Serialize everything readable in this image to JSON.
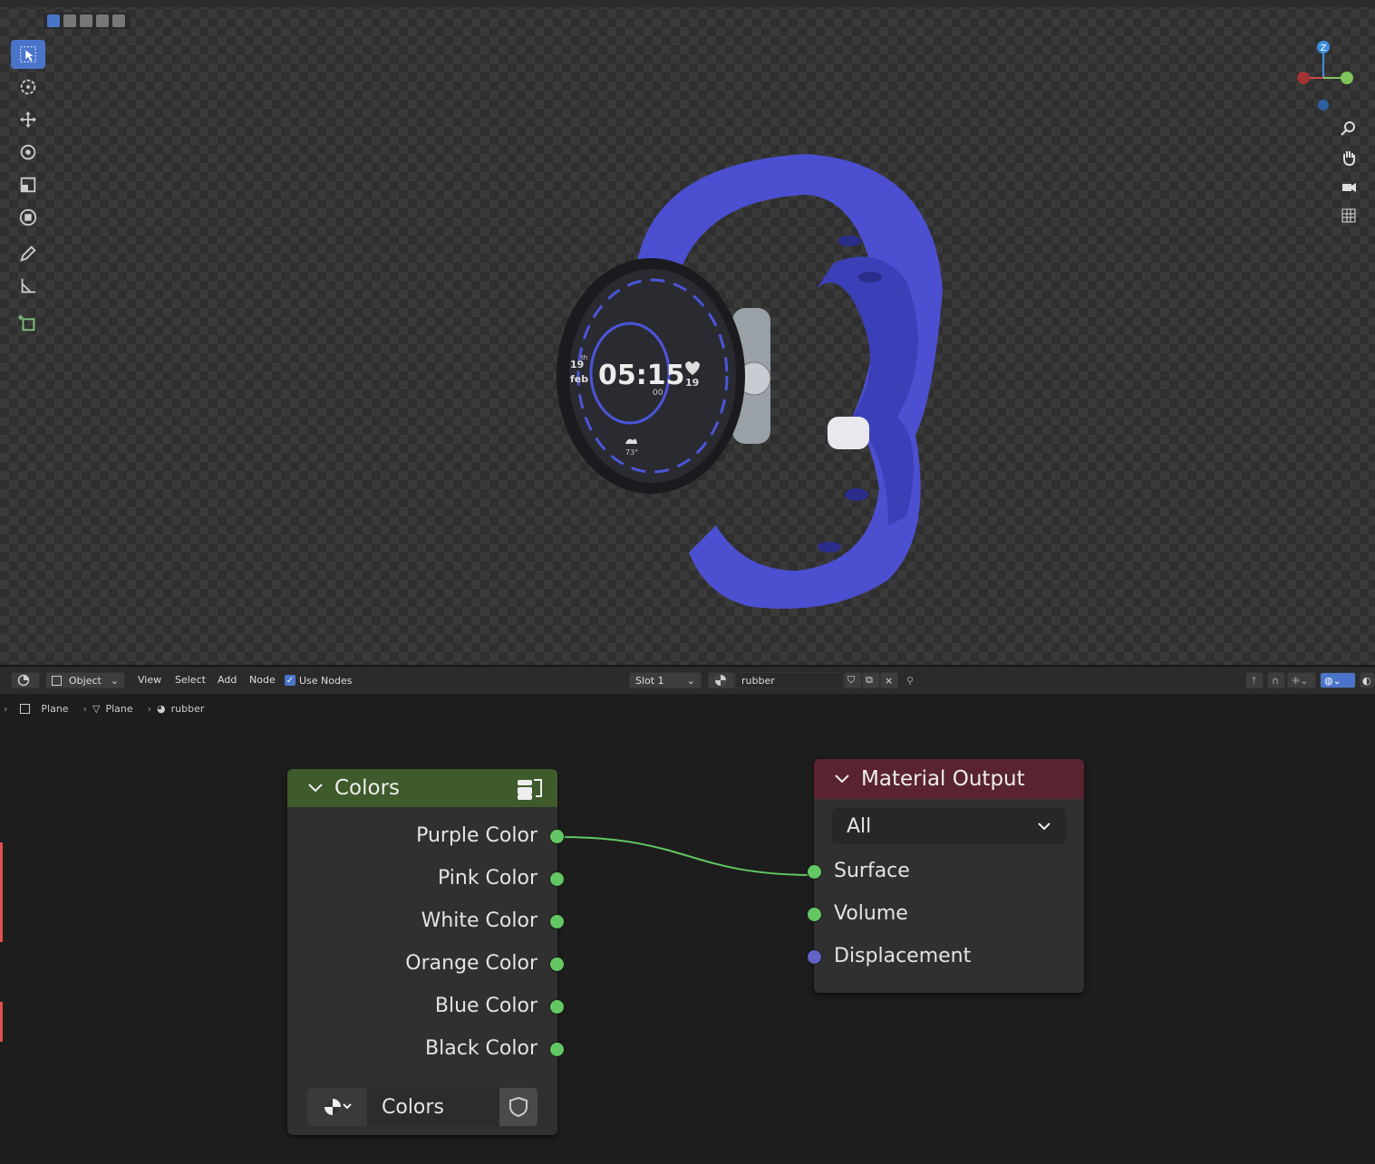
{
  "viewport": {
    "watch_face": {
      "time": "05:15",
      "seconds": "00",
      "day": "19",
      "day_suffix": "th",
      "month": "feb",
      "heart_rate": "19",
      "temperature": "73°"
    },
    "gizmo": {
      "z_label": "Z"
    }
  },
  "node_editor": {
    "header": {
      "mode": "Object",
      "menus": [
        "View",
        "Select",
        "Add",
        "Node"
      ],
      "use_nodes_label": "Use Nodes",
      "use_nodes_checked": true,
      "slot": "Slot 1",
      "material": "rubber"
    },
    "breadcrumb": [
      "Plane",
      "Plane",
      "rubber"
    ],
    "colors_node": {
      "title": "Colors",
      "outputs": [
        "Purple Color",
        "Pink Color",
        "White Color",
        "Orange Color",
        "Blue Color",
        "Black Color"
      ],
      "group_name": "Colors",
      "header_color": "#3f5a2b"
    },
    "material_output_node": {
      "title": "Material Output",
      "target": "All",
      "inputs": [
        "Surface",
        "Volume",
        "Displacement"
      ],
      "header_color": "#5a2330"
    }
  },
  "colors": {
    "accent": "#4a74c9",
    "socket_green": "#63c763",
    "socket_purple": "#6363c7",
    "strap": "#4b4fd0"
  }
}
